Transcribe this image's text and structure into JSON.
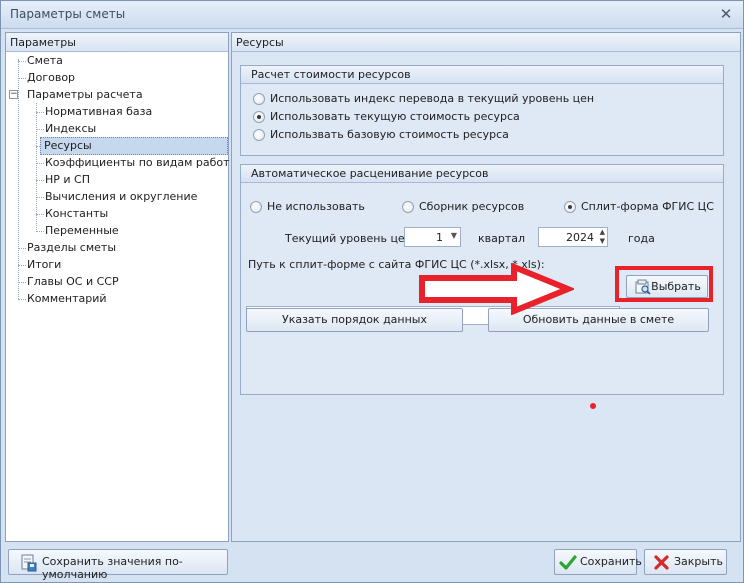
{
  "window": {
    "title": "Параметры сметы",
    "close_glyph": "✕"
  },
  "tree": {
    "header": "Параметры",
    "items": [
      {
        "label": "Смета"
      },
      {
        "label": "Договор"
      },
      {
        "label": "Параметры расчета",
        "expander": "−"
      },
      {
        "label": "Нормативная база"
      },
      {
        "label": "Индексы"
      },
      {
        "label": "Ресурсы",
        "selected": true
      },
      {
        "label": "Коэффициенты по видам работ"
      },
      {
        "label": "НР и СП"
      },
      {
        "label": "Вычисления и округление"
      },
      {
        "label": "Константы"
      },
      {
        "label": "Переменные"
      },
      {
        "label": "Разделы сметы"
      },
      {
        "label": "Итоги"
      },
      {
        "label": "Главы ОС и ССР"
      },
      {
        "label": "Комментарий"
      }
    ]
  },
  "main": {
    "header": "Ресурсы",
    "cost_group": {
      "title": "Расчет стоимости ресурсов",
      "options": [
        {
          "label": "Использовать индекс перевода в текущий уровень цен",
          "checked": false
        },
        {
          "label": "Использовать текущую стоимость ресурса",
          "checked": true
        },
        {
          "label": "Использвать базовую стоимость ресурса",
          "checked": false
        }
      ]
    },
    "auto_group": {
      "title": "Автоматическое расценивание ресурсов",
      "options": [
        {
          "label": "Не использовать",
          "checked": false
        },
        {
          "label": "Сборник ресурсов",
          "checked": false
        },
        {
          "label": "Сплит-форма ФГИС ЦС",
          "checked": true
        }
      ],
      "price_level_label": "Текущий уровень цен",
      "quarter_value": "1",
      "quarter_label": "квартал",
      "year_value": "2024",
      "year_label": "года",
      "path_label": "Путь к сплит-форме с сайта ФГИС ЦС (*.xlsx, *.xls):",
      "path_value": "",
      "choose_button": "Выбрать",
      "order_button": "Указать порядок данных",
      "update_button": "Обновить данные в смете"
    }
  },
  "footer": {
    "save_defaults": "Сохранить значения по-умолчанию",
    "save": "Сохранить",
    "close": "Закрыть"
  },
  "colors": {
    "annotation_red": "#e8212a",
    "selection": "#c6d8ee",
    "save_check": "#2fa52f",
    "close_x": "#d42a2a"
  },
  "icons": {
    "choose_button": "folder-search-icon",
    "save_defaults": "save-defaults-icon",
    "save": "checkmark-icon",
    "close": "close-icon",
    "annotation": "red-arrow-icon"
  }
}
